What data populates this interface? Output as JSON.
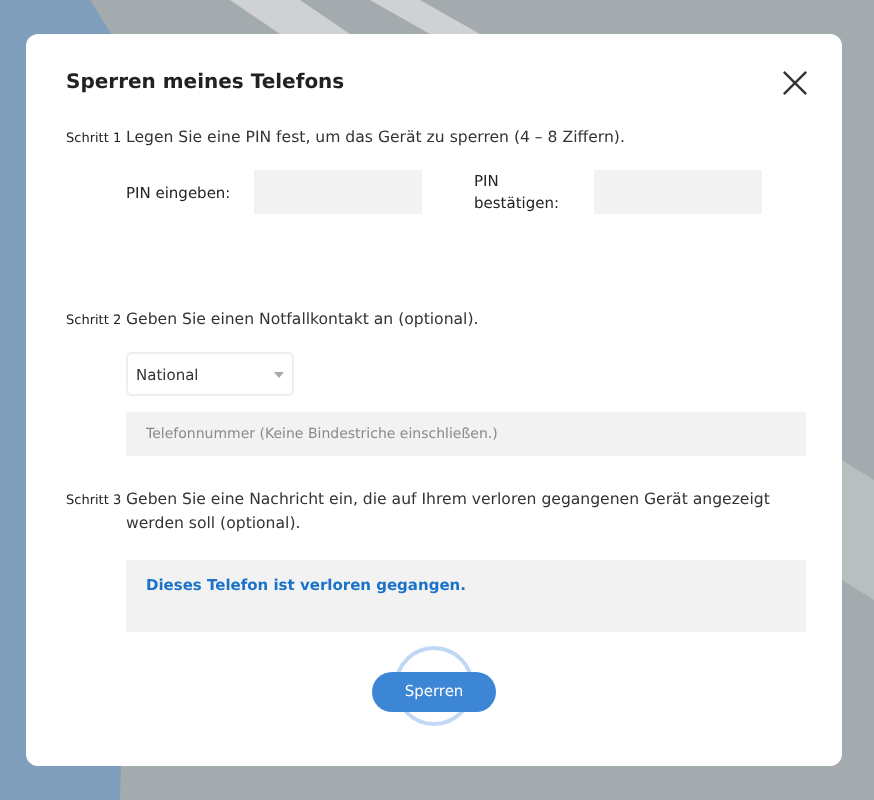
{
  "dialog": {
    "title": "Sperren meines Telefons"
  },
  "steps": [
    {
      "kind": "pin",
      "label": "Schritt 1",
      "text": "Legen Sie eine PIN fest, um das Gerät zu sperren (4 – 8 Ziffern).",
      "fields": [
        {
          "label": "PIN eingeben:"
        },
        {
          "label": "PIN bestätigen:"
        }
      ]
    },
    {
      "kind": "contact",
      "label": "Schritt 2",
      "text": "Geben Sie einen Notfallkontakt an (optional).",
      "dropdown": {
        "value": "National"
      },
      "phone": {
        "placeholder": "Telefonnummer (Keine Bindestriche einschließen.)"
      }
    },
    {
      "kind": "message",
      "label": "Schritt 3",
      "text": "Geben Sie eine Nachricht ein, die auf Ihrem verloren gegangenen Gerät angezeigt werden soll (optional).",
      "message": {
        "value": "Dieses Telefon ist verloren gegangen."
      }
    }
  ],
  "button": {
    "label": "Sperren"
  }
}
